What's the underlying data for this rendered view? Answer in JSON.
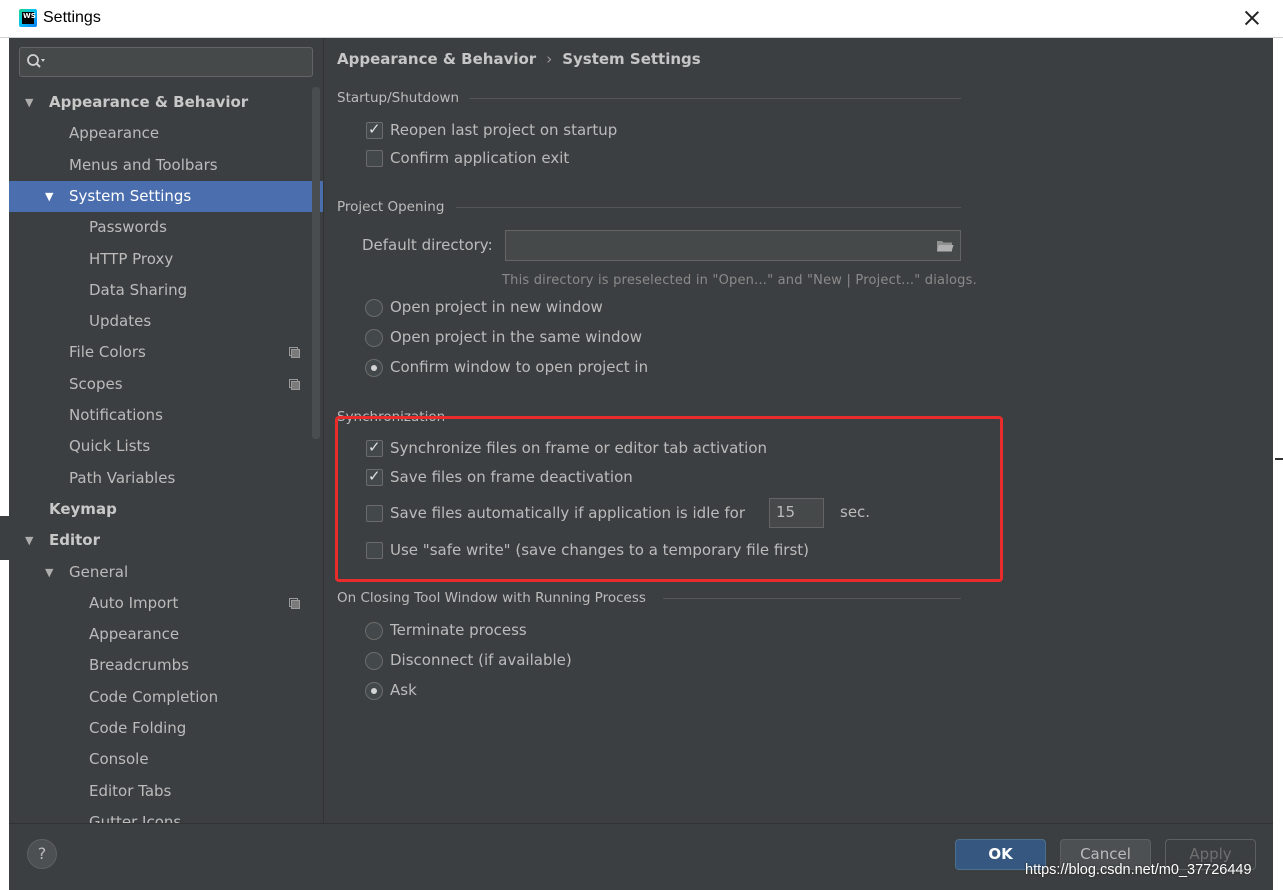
{
  "window": {
    "title": "Settings",
    "app_icon_text": "WS"
  },
  "sidebar": {
    "search_placeholder": "",
    "items": [
      {
        "label": "Appearance & Behavior",
        "expanded": true
      },
      {
        "label": "Appearance"
      },
      {
        "label": "Menus and Toolbars"
      },
      {
        "label": "System Settings",
        "expanded": true,
        "selected": true
      },
      {
        "label": "Passwords"
      },
      {
        "label": "HTTP Proxy"
      },
      {
        "label": "Data Sharing"
      },
      {
        "label": "Updates"
      },
      {
        "label": "File Colors",
        "project_icon": true
      },
      {
        "label": "Scopes",
        "project_icon": true
      },
      {
        "label": "Notifications"
      },
      {
        "label": "Quick Lists"
      },
      {
        "label": "Path Variables"
      },
      {
        "label": "Keymap"
      },
      {
        "label": "Editor",
        "expanded": true
      },
      {
        "label": "General",
        "expanded": true
      },
      {
        "label": "Auto Import",
        "project_icon": true
      },
      {
        "label": "Appearance"
      },
      {
        "label": "Breadcrumbs"
      },
      {
        "label": "Code Completion"
      },
      {
        "label": "Code Folding"
      },
      {
        "label": "Console"
      },
      {
        "label": "Editor Tabs"
      },
      {
        "label": "Gutter Icons"
      }
    ]
  },
  "breadcrumb": {
    "parent": "Appearance & Behavior",
    "separator": "›",
    "current": "System Settings"
  },
  "startup": {
    "title": "Startup/Shutdown",
    "reopen": {
      "label": "Reopen last project on startup",
      "checked": true
    },
    "confirm_exit": {
      "label": "Confirm application exit",
      "checked": false
    }
  },
  "project_opening": {
    "title": "Project Opening",
    "default_dir_label": "Default directory:",
    "default_dir_value": "",
    "hint": "This directory is preselected in \"Open...\" and \"New | Project...\" dialogs.",
    "options": [
      {
        "label": "Open project in new window",
        "checked": false
      },
      {
        "label": "Open project in the same window",
        "checked": false
      },
      {
        "label": "Confirm window to open project in",
        "checked": true
      }
    ]
  },
  "sync": {
    "title": "Synchronization",
    "sync_files": {
      "label": "Synchronize files on frame or editor tab activation",
      "checked": true
    },
    "save_deactivation": {
      "label": "Save files on frame deactivation",
      "checked": true
    },
    "save_idle": {
      "label": "Save files automatically if application is idle for",
      "checked": false,
      "value": "15",
      "unit": "sec."
    },
    "safe_write": {
      "label": "Use \"safe write\" (save changes to a temporary file first)",
      "checked": false
    }
  },
  "closing_tool": {
    "title": "On Closing Tool Window with Running Process",
    "options": [
      {
        "label": "Terminate process",
        "checked": false
      },
      {
        "label": "Disconnect (if available)",
        "checked": false
      },
      {
        "label": "Ask",
        "checked": true
      }
    ]
  },
  "footer": {
    "help": "?",
    "ok": "OK",
    "cancel": "Cancel",
    "apply": "Apply"
  },
  "watermark": "https://blog.csdn.net/m0_37726449",
  "colors": {
    "selection": "#4b6eaf",
    "highlight_box": "#e82c2c",
    "ok_button": "#365880"
  }
}
